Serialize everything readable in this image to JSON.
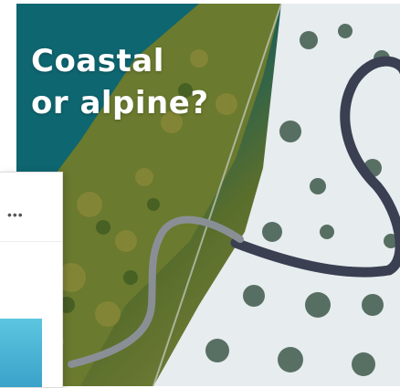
{
  "hero": {
    "headline_line1": "Coastal",
    "headline_line2": "or alpine?",
    "image_subject": "aerial view of winding coastal and snowy alpine roads"
  },
  "side_card": {
    "menu_icon": "more-horizontal-icon"
  },
  "colors": {
    "sea": "#0f6a72",
    "forest": "#5a6e2c",
    "snow": "#e9eef0",
    "road": "#3a3f52",
    "accent_blue": "#3aa2c9"
  }
}
